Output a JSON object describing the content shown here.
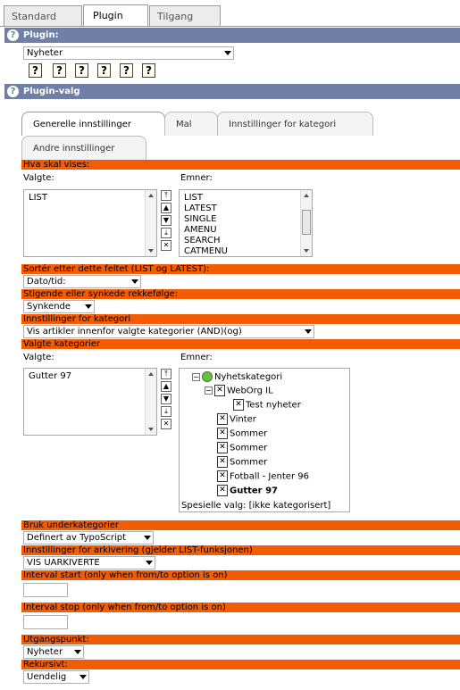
{
  "tabs": [
    "Standard",
    "Plugin",
    "Tilgang"
  ],
  "plugin_section": {
    "title": "Plugin:",
    "selected": "Nyheter",
    "help_icon_count": 6
  },
  "plugin_options_section": {
    "title": "Plugin-valg"
  },
  "subtabs": [
    "Generelle innstillinger",
    "Mal",
    "Innstillinger for kategori",
    "Andre innstillinger"
  ],
  "what_to_show": {
    "header": "Hva skal vises:",
    "selected_label": "Valgte:",
    "selected_items": [
      "LIST"
    ],
    "items_label": "Emner:",
    "items": [
      "LIST",
      "LATEST",
      "SINGLE",
      "AMENU",
      "SEARCH",
      "CATMENU"
    ]
  },
  "sort_field": {
    "header": "Sortér etter dette feltet (LIST og LATEST):",
    "value": "Dato/tid:"
  },
  "sort_order": {
    "header": "Stigende eller synkede rekkefølge:",
    "value": "Synkende"
  },
  "category_settings": {
    "header": "Innstillinger for kategori",
    "value": "Vis artikler innenfor valgte kategorier (AND)(og)"
  },
  "selected_categories": {
    "header": "Valgte kategorier",
    "selected_label": "Valgte:",
    "selected_items": [
      "Gutter 97"
    ],
    "items_label": "Emner:",
    "tree": [
      {
        "label": "Nyhetskategori",
        "level": 0,
        "bold": false
      },
      {
        "label": "WebOrg IL",
        "level": 1,
        "bold": false
      },
      {
        "label": "Test nyheter",
        "level": 2,
        "bold": false
      },
      {
        "label": "Vinter",
        "level": 1,
        "bold": false
      },
      {
        "label": "Sommer",
        "level": 1,
        "bold": false
      },
      {
        "label": "Sommer",
        "level": 1,
        "bold": false
      },
      {
        "label": "Sommer",
        "level": 1,
        "bold": false
      },
      {
        "label": "Fotball - Jenter 96",
        "level": 1,
        "bold": false
      },
      {
        "label": "Gutter 97",
        "level": 1,
        "bold": true
      }
    ],
    "special": "Spesielle valg: [ikke kategorisert]"
  },
  "use_subcategories": {
    "header": "Bruk underkategorier",
    "value": "Definert av TypoScript"
  },
  "archive_settings": {
    "header": "Innstillinger for arkivering (gjelder LIST-funksjonen)",
    "value": "VIS UARKIVERTE"
  },
  "interval_start": {
    "header": "Interval start (only when from/to option is on)",
    "value": ""
  },
  "interval_stop": {
    "header": "Interval stop (only when from/to option is on)",
    "value": ""
  },
  "starting_point": {
    "header": "Utgangspunkt:",
    "value": "Nyheter"
  },
  "recursive": {
    "header": "Rekursivt:",
    "value": "Uendelig"
  },
  "colors": {
    "section_bar": "#6f7fa6",
    "orange_bar": "#f25c05"
  }
}
